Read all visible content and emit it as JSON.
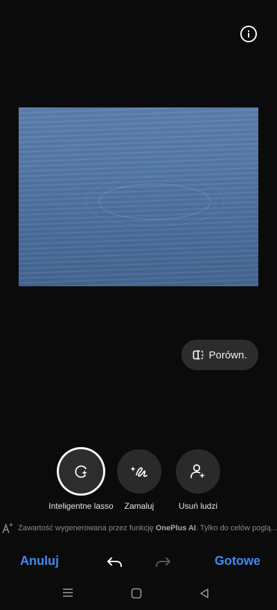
{
  "header": {
    "info_icon": "info-icon"
  },
  "compare": {
    "label": "Porówn.",
    "icon": "compare-split-icon"
  },
  "tools": [
    {
      "label": "Inteligentne lasso",
      "icon": "smart-lasso-icon",
      "active": true
    },
    {
      "label": "Zamaluj",
      "icon": "paint-over-icon",
      "active": false
    },
    {
      "label": "Usuń ludzi",
      "icon": "remove-people-icon",
      "active": false
    }
  ],
  "disclaimer": {
    "prefix": "Zawartość wygenerowana przez funkcję",
    "brand": "OnePlus AI",
    "suffix": ". Tylko do celów poglą..."
  },
  "actions": {
    "cancel": "Anuluj",
    "done": "Gotowe"
  },
  "colors": {
    "accent": "#3f8bf0",
    "background": "#0b0b0c",
    "tool_bg": "#2a2a2c"
  }
}
